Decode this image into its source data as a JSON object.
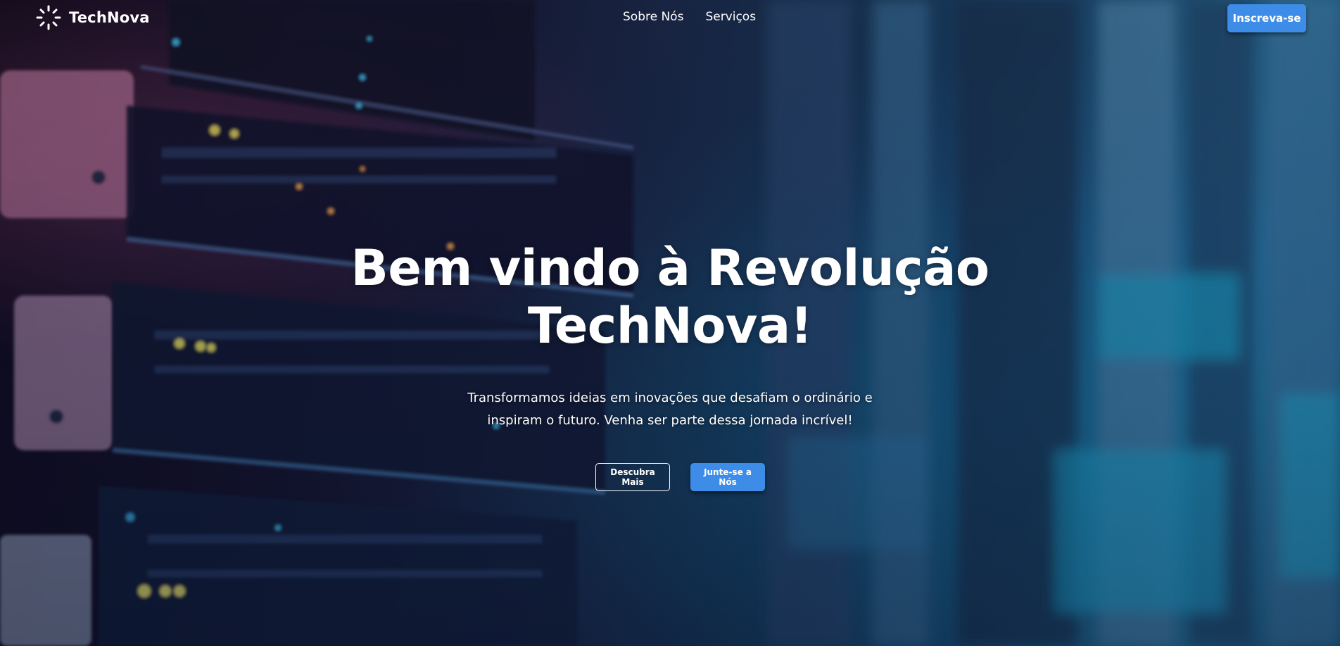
{
  "brand": {
    "name": "TechNova",
    "icon": "sparkle-burst-icon"
  },
  "nav": {
    "items": [
      {
        "label": "Sobre Nós"
      },
      {
        "label": "Serviços"
      }
    ],
    "cta_label": "Inscreva-se"
  },
  "hero": {
    "title_line1": "Bem vindo à Revolução",
    "title_line2": "TechNova!",
    "subtitle_line1": "Transformamos ideias em inovações que desafiam o ordinário e",
    "subtitle_line2": "inspiram o futuro. Venha ser parte dessa jornada incrível!",
    "primary_button": "Descubra Mais",
    "secondary_button": "Junte-se a Nós",
    "background": "blurred-server-rack-photo"
  },
  "colors": {
    "accent": "#3d8de8",
    "text": "#ffffff"
  }
}
